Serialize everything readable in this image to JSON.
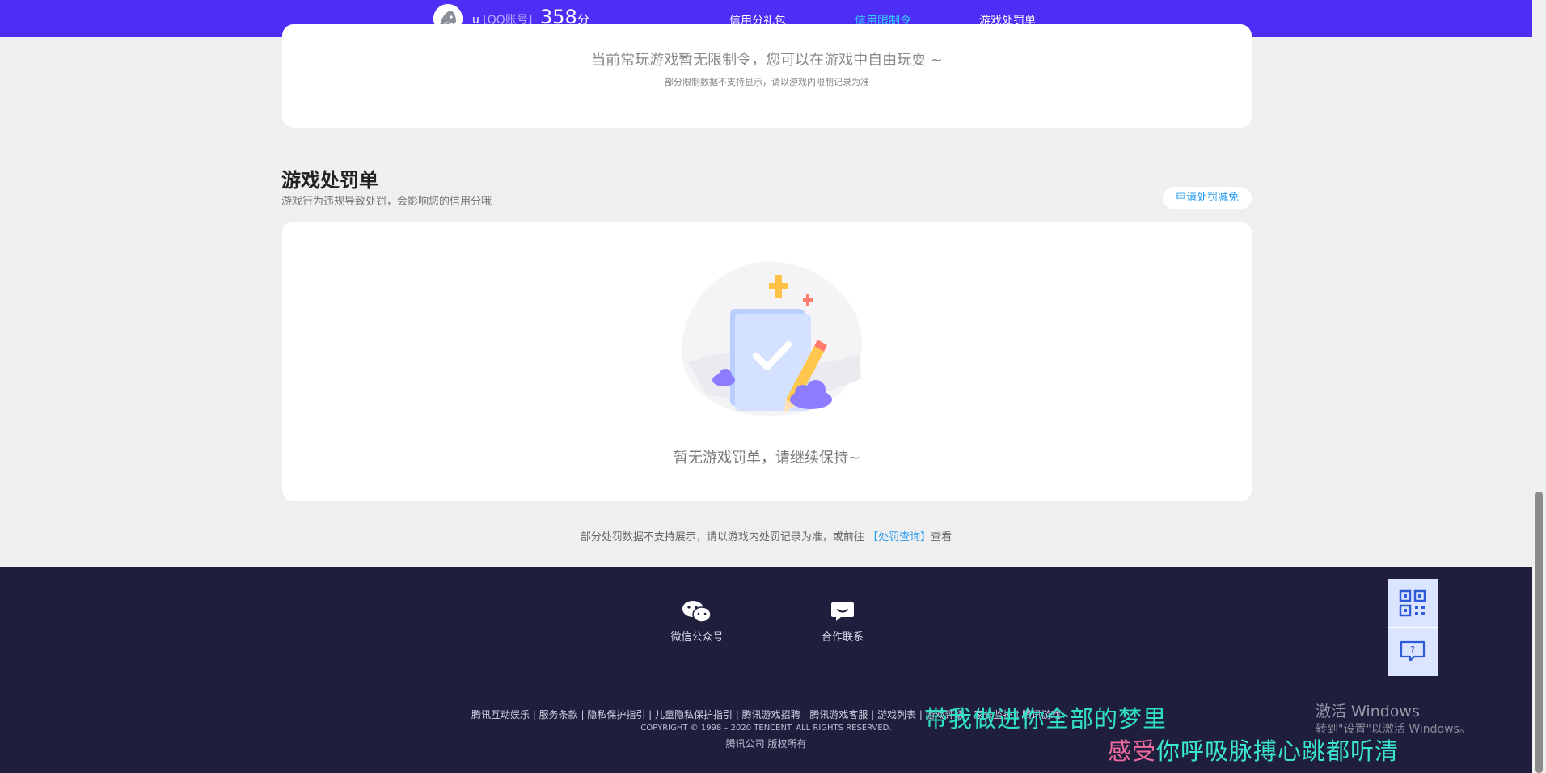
{
  "header": {
    "username": "u",
    "account_type": "[QQ账号]",
    "score": "358",
    "score_unit": "分",
    "nav": [
      {
        "label": "信用分礼包"
      },
      {
        "label": "信用限制令"
      },
      {
        "label": "游戏处罚单"
      }
    ]
  },
  "restriction": {
    "message": "当前常玩游戏暂无限制令，您可以在游戏中自由玩耍 ~",
    "note": "部分限制数据不支持显示，请以游戏内限制记录为准"
  },
  "penalty": {
    "title": "游戏处罚单",
    "description": "游戏行为违规导致处罚，会影响您的信用分哦",
    "appeal_button": "申请处罚减免",
    "empty_message": "暂无游戏罚单，请继续保持~",
    "note_prefix": "部分处罚数据不支持展示，请以游戏内处罚记录为准，或前往",
    "note_link": "【处罚查询】",
    "note_suffix": "查看"
  },
  "footer": {
    "wechat_label": "微信公众号",
    "contact_label": "合作联系",
    "links": "腾讯互动娱乐 | 服务条款 | 隐私保护指引 | 儿童隐私保护指引 | 腾讯游戏招聘 | 腾讯游戏客服 | 游戏列表 | 游戏评级 | 家长监护 | 腾讯游戏",
    "copyright": "COPYRIGHT © 1998 – 2020 TENCENT. ALL RIGHTS RESERVED.",
    "corp": "腾讯公司 版权所有"
  },
  "side_tools": {
    "icons": [
      "qr-code-icon",
      "feedback-icon"
    ]
  },
  "windows_watermark": {
    "title": "激活 Windows",
    "subtitle": "转到\"设置\"以激活 Windows。"
  },
  "lyrics": {
    "line1": "带我做进你全部的梦里",
    "line2_pink": "感受",
    "line2_rest": "你呼吸脉搏心跳都听清"
  },
  "colors": {
    "nav_bg": "#4e2ef5",
    "active_nav": "#36d2ff",
    "footer_bg": "#1f1f3d",
    "link": "#2a9cf2"
  }
}
